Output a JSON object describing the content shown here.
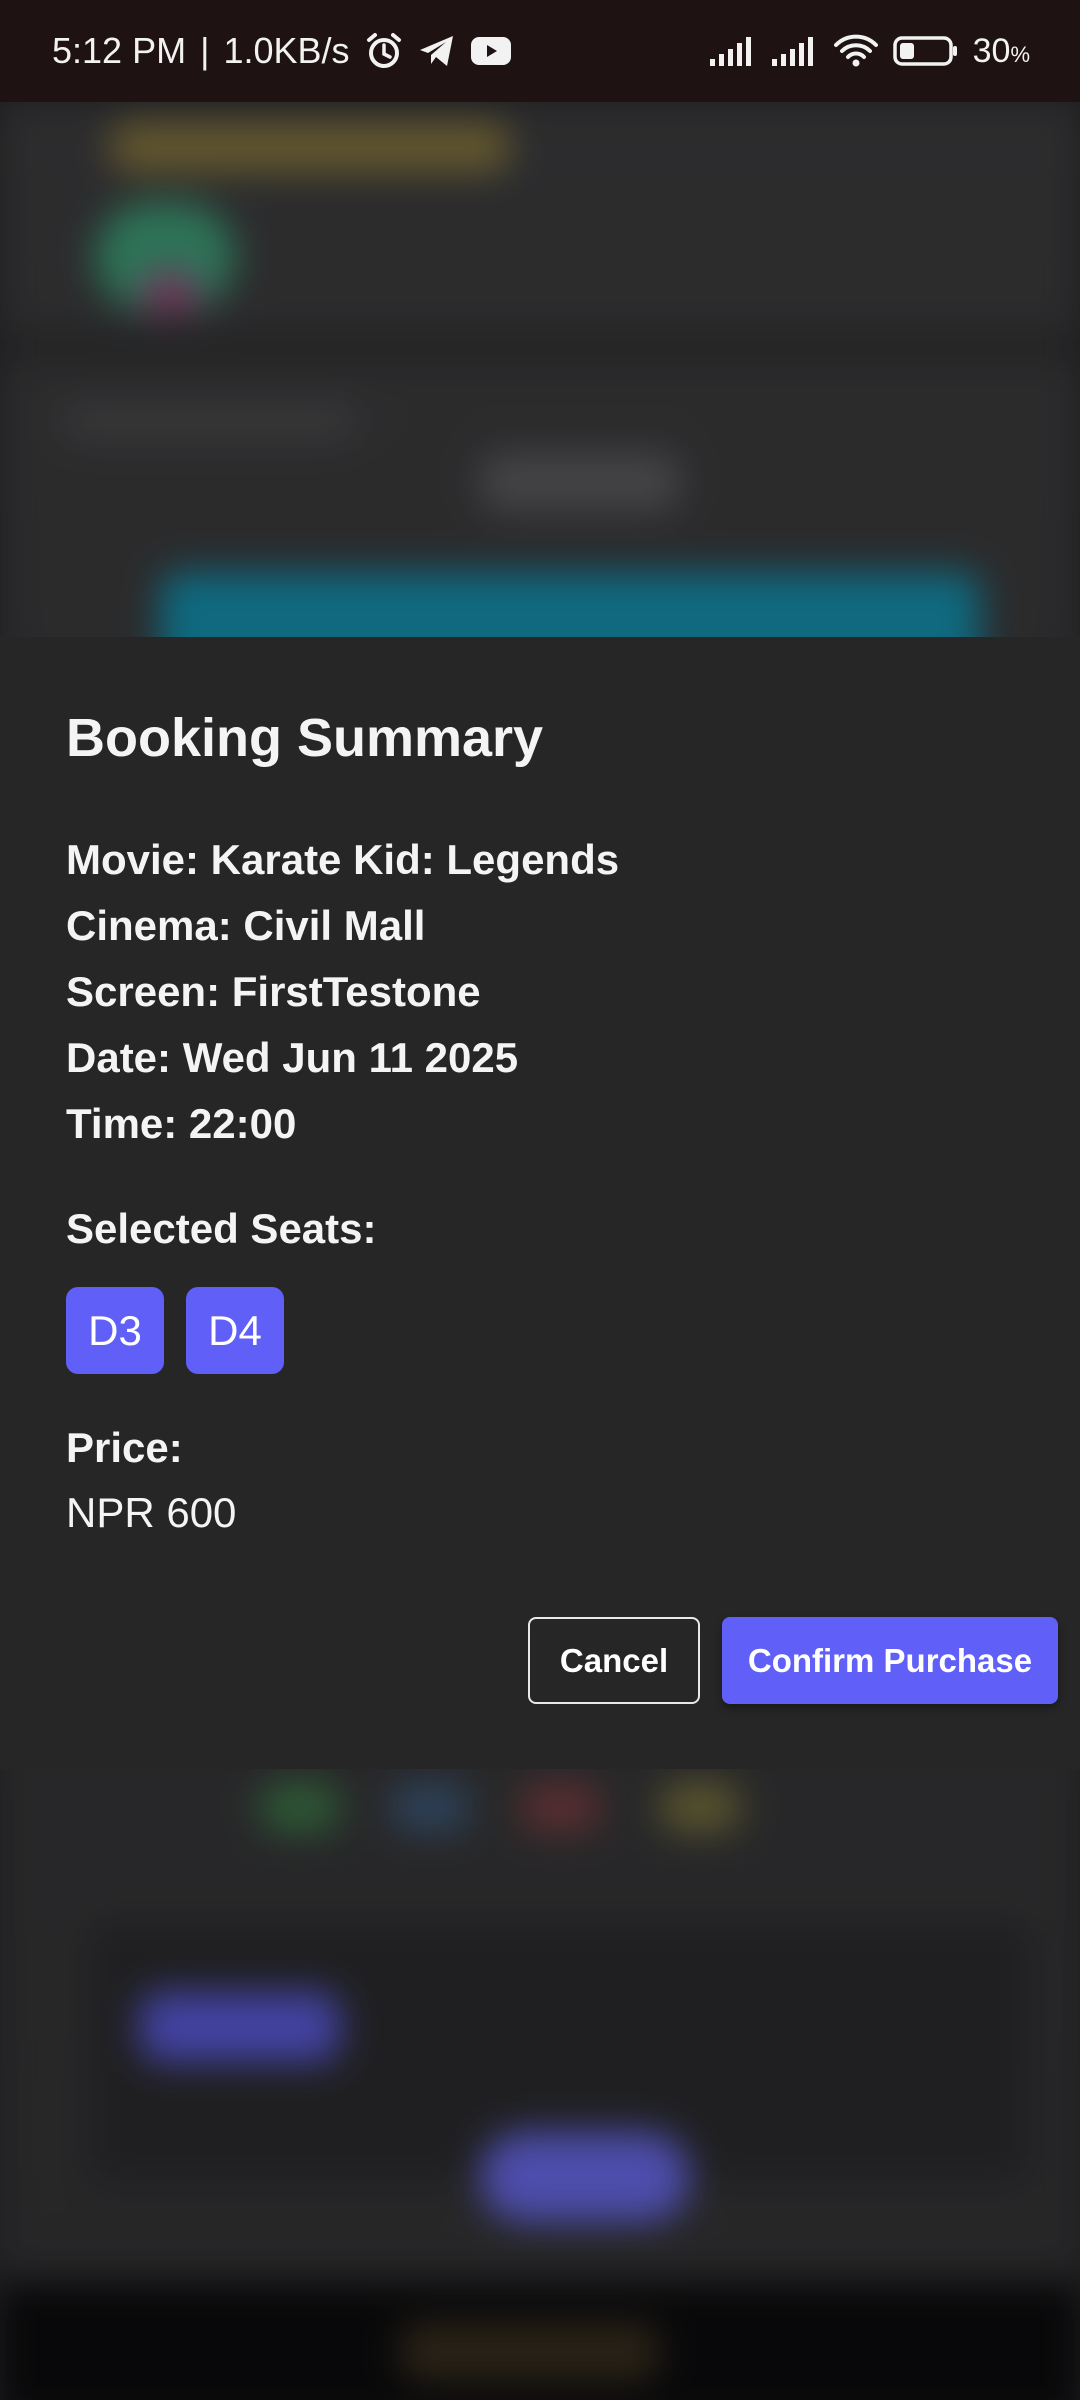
{
  "status_bar": {
    "time": "5:12 PM",
    "separator": "|",
    "net_speed": "1.0KB/s",
    "icons": [
      "alarm-icon",
      "telegram-icon",
      "youtube-icon",
      "signal-icon",
      "signal-icon",
      "wifi-icon",
      "battery-icon"
    ],
    "battery_value": "30",
    "battery_unit": "%"
  },
  "dialog": {
    "title": "Booking Summary",
    "details": {
      "movie": "Movie: Karate Kid: Legends",
      "cinema": "Cinema: Civil Mall",
      "screen": "Screen: FirstTestone",
      "date": "Date: Wed Jun 11 2025",
      "time": "Time: 22:00"
    },
    "seats_heading": "Selected Seats:",
    "seats": [
      "D3",
      "D4"
    ],
    "price_label": "Price:",
    "price_value": "NPR 600",
    "cancel_label": "Cancel",
    "confirm_label": "Confirm Purchase"
  },
  "colors": {
    "accent": "#6060f8",
    "dialog_bg": "#262626",
    "status_bar_bg": "#1e1212"
  }
}
